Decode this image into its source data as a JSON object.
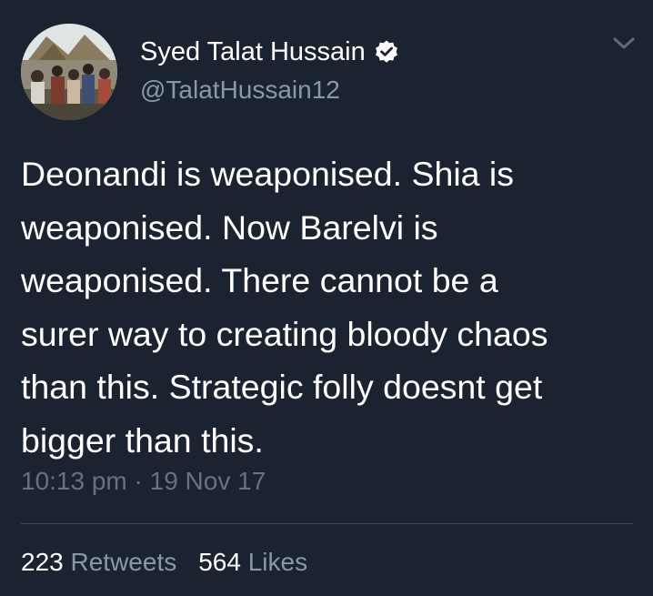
{
  "user": {
    "display_name": "Syed Talat Hussain",
    "handle": "@TalatHussain12",
    "verified": true,
    "avatar_icon": "profile-photo-crowd",
    "verified_icon": "verified-badge-icon"
  },
  "menu": {
    "icon": "chevron-down-icon"
  },
  "tweet": {
    "text_lines": [
      "Deonandi is weaponised. Shia is",
      "weaponised. Now Barelvi is",
      "weaponised. There cannot be a",
      "surer way to creating bloody chaos",
      "than this. Strategic folly doesnt get",
      "bigger than this."
    ],
    "timestamp": "10:13 pm · 19 Nov 17"
  },
  "stats": {
    "retweets_count": "223",
    "retweets_label": "Retweets",
    "likes_count": "564",
    "likes_label": "Likes"
  },
  "colors": {
    "background": "#1c2330",
    "primary_text": "#ffffff",
    "secondary_text": "#8899a6",
    "divider": "#404b57"
  }
}
